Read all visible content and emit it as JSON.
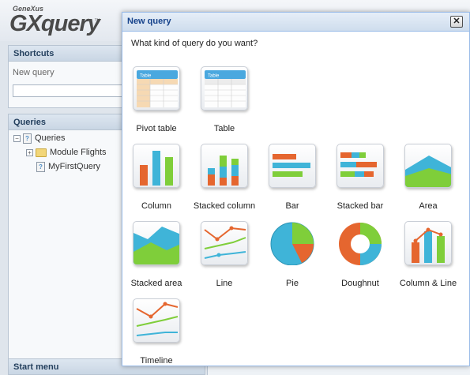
{
  "app": {
    "brand_small": "GeneXus",
    "brand_big": "GXquery",
    "brand_tm": "™",
    "shortcuts": {
      "title": "Shortcuts",
      "new_query_label": "New query"
    },
    "queries": {
      "title": "Queries",
      "tree": [
        {
          "label": "Queries",
          "toggle": "−"
        },
        {
          "label": "Module Flights",
          "toggle": "+"
        },
        {
          "label": "MyFirstQuery"
        }
      ]
    },
    "start_menu": {
      "title": "Start menu"
    }
  },
  "dialog": {
    "title": "New query",
    "close_symbol": "✕",
    "prompt": "What kind of query do you want?",
    "options": [
      {
        "label": "Pivot table"
      },
      {
        "label": "Table"
      },
      {
        "label": "Column"
      },
      {
        "label": "Stacked column"
      },
      {
        "label": "Bar"
      },
      {
        "label": "Stacked bar"
      },
      {
        "label": "Area"
      },
      {
        "label": "Stacked area"
      },
      {
        "label": "Line"
      },
      {
        "label": "Pie"
      },
      {
        "label": "Doughnut"
      },
      {
        "label": "Column & Line"
      },
      {
        "label": "Timeline"
      }
    ]
  },
  "colors": {
    "orange": "#e5662f",
    "teal": "#3fb4d8",
    "green": "#7fce3a",
    "header_blue": "#15428b"
  }
}
